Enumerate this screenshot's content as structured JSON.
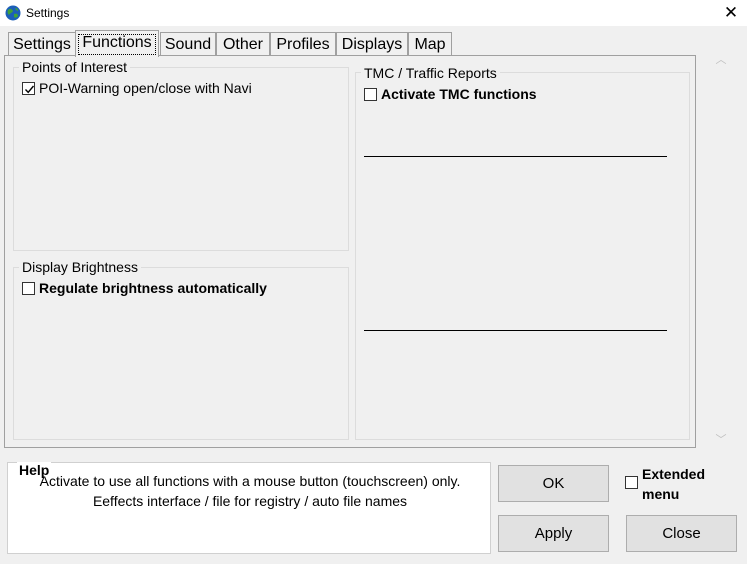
{
  "window": {
    "title": "Settings",
    "icon": "globe-icon",
    "close_symbol": "✕"
  },
  "tabs": [
    {
      "label": "Settings",
      "active": false
    },
    {
      "label": "Functions",
      "active": true
    },
    {
      "label": "Sound",
      "active": false
    },
    {
      "label": "Other",
      "active": false
    },
    {
      "label": "Profiles",
      "active": false
    },
    {
      "label": "Displays",
      "active": false
    },
    {
      "label": "Map",
      "active": false
    }
  ],
  "functions": {
    "poi": {
      "title": "Points of Interest",
      "option": {
        "label": "POI-Warning open/close with Navi",
        "checked": true
      }
    },
    "brightness": {
      "title": "Display Brightness",
      "option": {
        "label": "Regulate brightness automatically",
        "checked": false
      }
    },
    "tmc": {
      "title": "TMC / Traffic Reports",
      "option": {
        "label": "Activate TMC functions",
        "checked": false
      }
    }
  },
  "scroll": {
    "up_symbol": "︿",
    "down_symbol": "﹀"
  },
  "help": {
    "title": "Help",
    "line1": "Activate to use all functions with a mouse button (touchscreen) only.",
    "line2": "Eeffects interface / file for registry / auto file names"
  },
  "buttons": {
    "ok": "OK",
    "apply": "Apply",
    "close": "Close"
  },
  "extended_menu": {
    "line1": "Extended",
    "line2": "menu",
    "checked": false
  },
  "colors": {
    "background": "#f0f0f0",
    "button": "#e1e1e1",
    "border": "#a0a0a0"
  }
}
